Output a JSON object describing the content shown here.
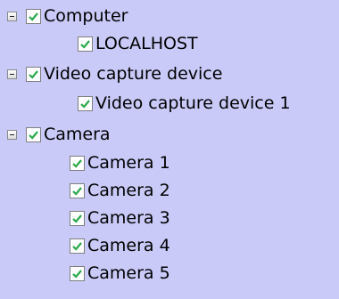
{
  "tree": {
    "computer": {
      "label": "Computer",
      "child": "LOCALHOST"
    },
    "video": {
      "label": "Video capture device",
      "child": "Video capture device 1"
    },
    "camera": {
      "label": "Camera",
      "children": [
        "Camera 1",
        "Camera 2",
        "Camera 3",
        "Camera 4",
        "Camera 5"
      ]
    },
    "icons": {
      "expander": "collapse-minus-icon",
      "checkbox": "checkmark-icon"
    },
    "colors": {
      "background": "#c9caf8",
      "check": "#2aa84a"
    }
  }
}
